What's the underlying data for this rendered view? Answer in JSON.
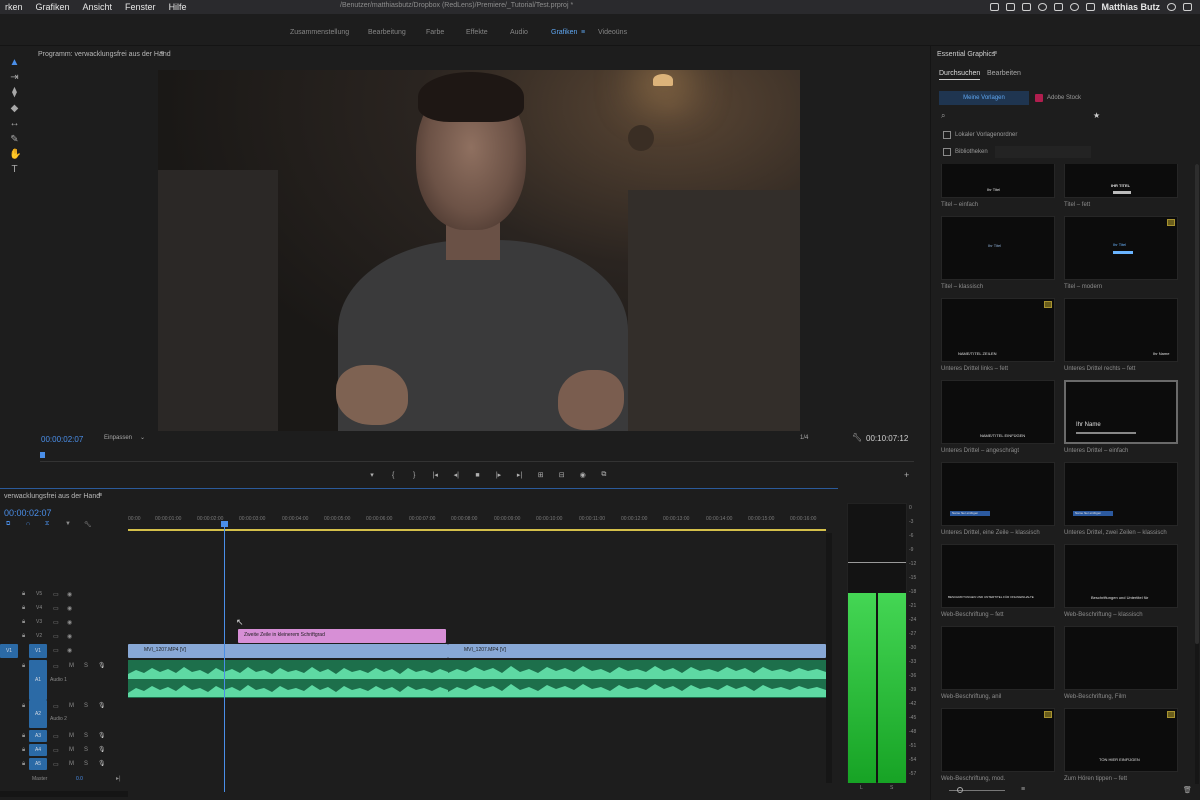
{
  "menubar": {
    "items": [
      "rken",
      "Grafiken",
      "Ansicht",
      "Fenster",
      "Hilfe"
    ],
    "document_path": "/Benutzer/matthiasbutz/Dropbox (RedLens)/Premiere/_Tutorial/Test.prproj *",
    "user": "Matthias Butz"
  },
  "workspaces": {
    "tabs": [
      "Zusammenstellung",
      "Bearbeitung",
      "Farbe",
      "Effekte",
      "Audio",
      "Grafiken",
      "≡",
      "Videoüns"
    ],
    "active": "Grafiken"
  },
  "program_monitor": {
    "title": "Programm: verwacklungsfrei aus der Hand",
    "menu_icon": "≡",
    "timecode": "00:00:02:07",
    "fit": "Einpassen",
    "resolution": "1/4",
    "duration": "00:10:07:12"
  },
  "transport": [
    "▾",
    "{",
    "}",
    "|◂",
    "◂|",
    "■",
    "|▸",
    "▸|",
    "⊞",
    "⊟",
    "◉",
    "⧉"
  ],
  "timeline": {
    "title": "verwacklungsfrei aus der Hand",
    "timecode": "00:00:02:07",
    "ticks": [
      "00:00",
      "00:00:01:00",
      "00:00:02:00",
      "00:00:03:00",
      "00:00:04:00",
      "00:00:05:00",
      "00:00:06:00",
      "00:00:07:00",
      "00:00:08:00",
      "00:00:09:00",
      "00:00:10:00",
      "00:00:11:00",
      "00:00:12:00",
      "00:00:13:00",
      "00:00:14:00",
      "00:00:15:00",
      "00:00:16:00"
    ],
    "video_tracks": [
      "V5",
      "V4",
      "V3",
      "V2",
      "V1"
    ],
    "audio_tracks": [
      "A1",
      "A2",
      "A3",
      "A4",
      "A5"
    ],
    "audio_names": [
      "Audio 1",
      "Audio 2"
    ],
    "toggles": {
      "m": "M",
      "s": "S"
    },
    "master": "Master",
    "master_value": "0.0",
    "clips": {
      "graphic": "Zweite Zeile in kleinerem Schriftgrad",
      "video_a": "MVI_1207.MP4 [V]",
      "video_b": "MVI_1207.MP4 [V]"
    }
  },
  "meter": {
    "scale": [
      "0",
      "-3",
      "-6",
      "-9",
      "-12",
      "-15",
      "-18",
      "-21",
      "-24",
      "-27",
      "-30",
      "-33",
      "-36",
      "-39",
      "-42",
      "-45",
      "-48",
      "-51",
      "-54",
      "-57"
    ],
    "channels": [
      "L",
      "S"
    ],
    "levels": [
      0.68,
      0.68
    ],
    "colors": {
      "meter": "#1fb532"
    }
  },
  "essential_graphics": {
    "title": "Essential Graphics",
    "menu_icon": "≡",
    "tabs": [
      "Durchsuchen",
      "Bearbeiten"
    ],
    "segments": [
      "Meine Vorlagen",
      "Adobe Stock"
    ],
    "local_label": "Lokaler Vorlagenordner",
    "libraries_label": "Bibliotheken",
    "templates": [
      {
        "name": "Titel – einfach",
        "text": "Ihr Titel",
        "badge": false
      },
      {
        "name": "Titel – fett",
        "text": "IHR TITEL",
        "badge": false
      },
      {
        "name": "Titel – klassisch",
        "text": "Ihr Titel",
        "badge": false
      },
      {
        "name": "Titel – modern",
        "text": "Ihr Titel",
        "badge": true
      },
      {
        "name": "Unteres Drittel links – fett",
        "text": "NAME/TITEL ZEILEN",
        "badge": true
      },
      {
        "name": "Unteres Drittel rechts – fett",
        "text": "Ihr Name",
        "badge": false
      },
      {
        "name": "Unteres Drittel – angeschrägt",
        "text": "NAME/TITEL EINFÜGEN",
        "badge": false
      },
      {
        "name": "Unteres Drittel – einfach",
        "text": "Ihr Name",
        "badge": false
      },
      {
        "name": "Unteres Drittel, eine Zeile – klassisch",
        "text": "Name hier einfügen",
        "badge": false
      },
      {
        "name": "Unteres Drittel, zwei Zeilen – klassisch",
        "text": "Name hier einfügen",
        "badge": false
      },
      {
        "name": "Web-Beschriftung – fett",
        "text": "BESCHRIFTUNGEN UND UNTERTITEL FÜR ONLINEINHALTE",
        "badge": false
      },
      {
        "name": "Web-Beschriftung – klassisch",
        "text": "Beschriftungen und Untertitel für",
        "badge": false
      },
      {
        "name": "Web-Beschriftung, anil",
        "text": "",
        "badge": false
      },
      {
        "name": "Web-Beschriftung, Film",
        "text": "",
        "badge": false
      },
      {
        "name": "Web-Beschriftung, mod.",
        "text": "",
        "badge": true
      },
      {
        "name": "Zum Hören tippen – fett",
        "text": "TON HIER EINFÜGEN",
        "badge": true
      }
    ]
  }
}
